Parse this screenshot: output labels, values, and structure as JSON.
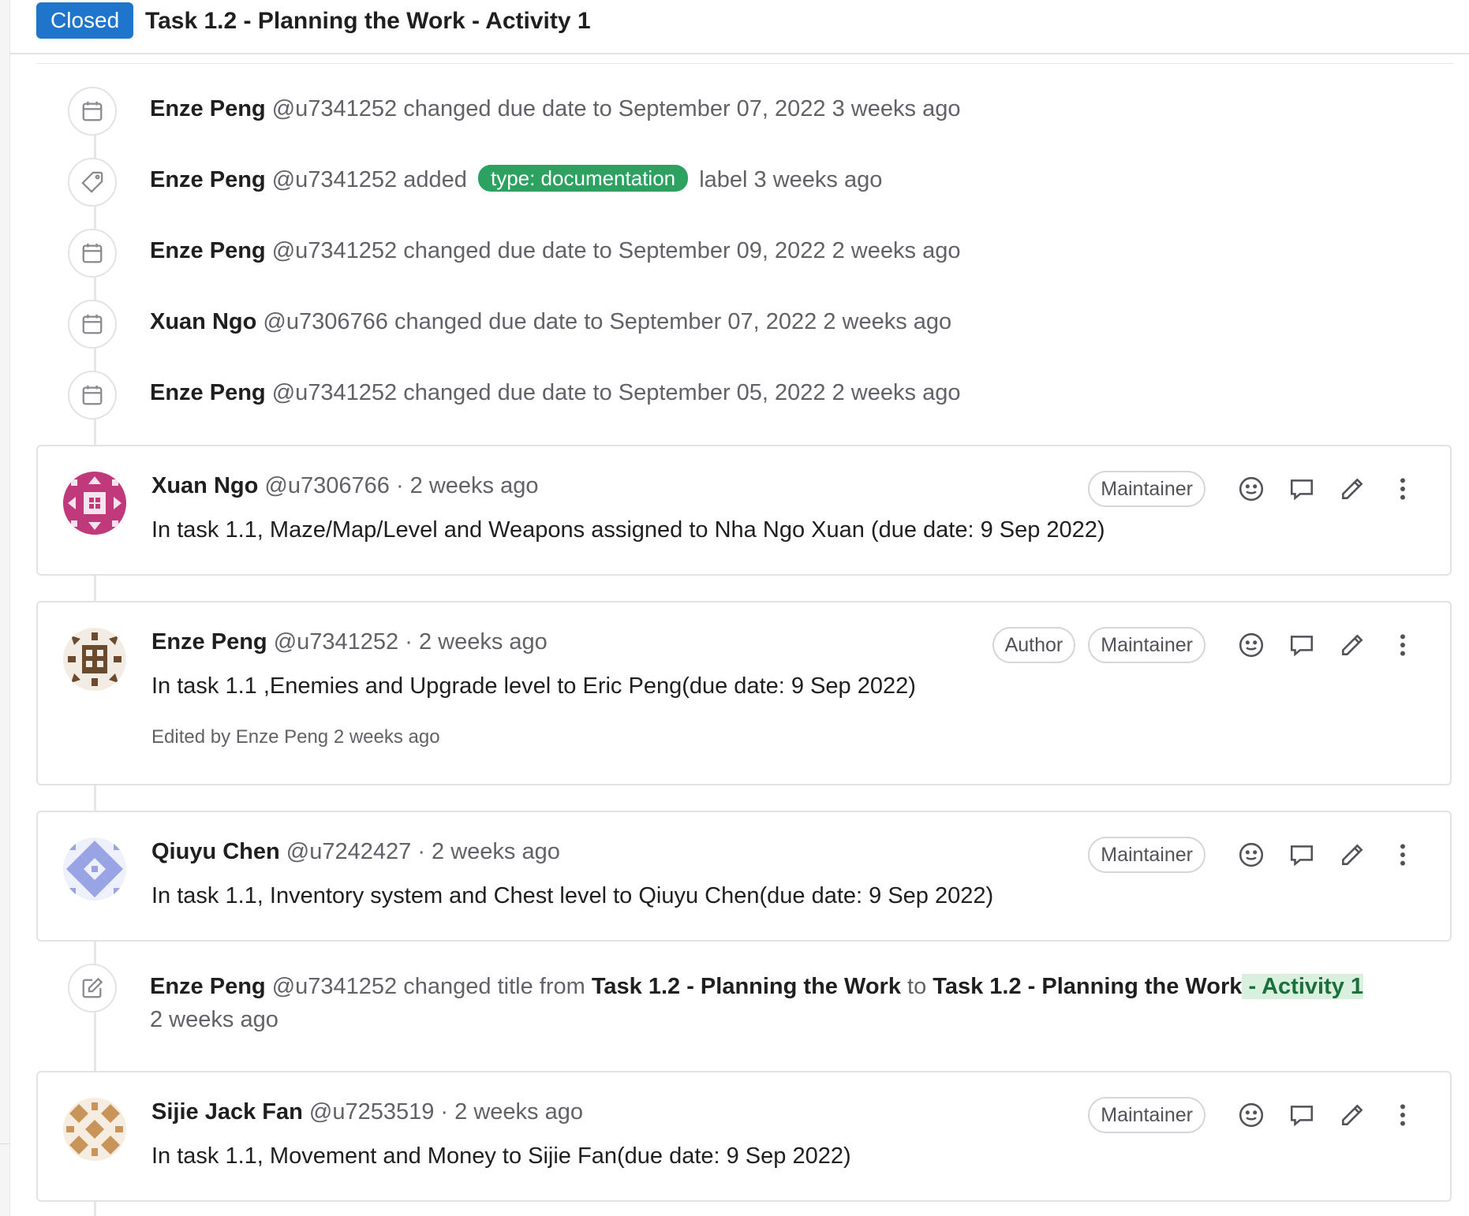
{
  "header": {
    "status": "Closed",
    "title": "Task 1.2 - Planning the Work - Activity 1"
  },
  "events": [
    {
      "icon": "calendar-icon",
      "author": "Enze Peng",
      "username": "@u7341252",
      "action": "changed due date to September 07, 2022",
      "time": "3 weeks ago"
    },
    {
      "icon": "tag-icon",
      "author": "Enze Peng",
      "username": "@u7341252",
      "action": "added",
      "label": "type: documentation",
      "action_suffix": "label",
      "time": "3 weeks ago",
      "label_color": "#2da160"
    },
    {
      "icon": "calendar-icon",
      "author": "Enze Peng",
      "username": "@u7341252",
      "action": "changed due date to September 09, 2022",
      "time": "2 weeks ago"
    },
    {
      "icon": "calendar-icon",
      "author": "Xuan Ngo",
      "username": "@u7306766",
      "action": "changed due date to September 07, 2022",
      "time": "2 weeks ago"
    },
    {
      "icon": "calendar-icon",
      "author": "Enze Peng",
      "username": "@u7341252",
      "action": "changed due date to September 05, 2022",
      "time": "2 weeks ago"
    }
  ],
  "comments": [
    {
      "author": "Xuan Ngo",
      "username": "@u7306766",
      "time": "· 2 weeks ago",
      "badges": [
        "Maintainer"
      ],
      "body": "In task 1.1, Maze/Map/Level and Weapons assigned to Nha Ngo Xuan (due date: 9 Sep 2022)",
      "avatar_color": "#c0397b"
    },
    {
      "author": "Enze Peng",
      "username": "@u7341252",
      "time": "· 2 weeks ago",
      "badges": [
        "Author",
        "Maintainer"
      ],
      "body": "In task 1.1 ,Enemies and Upgrade level to Eric Peng(due date: 9 Sep 2022)",
      "edited": "Edited by Enze Peng 2 weeks ago",
      "avatar_color": "#6b4a2e"
    },
    {
      "author": "Qiuyu Chen",
      "username": "@u7242427",
      "time": "· 2 weeks ago",
      "badges": [
        "Maintainer"
      ],
      "body": "In task 1.1, Inventory system and Chest level to Qiuyu Chen(due date: 9 Sep 2022)",
      "avatar_color": "#98a4e3"
    },
    {
      "author": "Sijie Jack Fan",
      "username": "@u7253519",
      "time": "· 2 weeks ago",
      "badges": [
        "Maintainer"
      ],
      "body": "In task 1.1, Movement and Money to Sijie Fan(due date: 9 Sep 2022)",
      "avatar_color": "#c8945a"
    }
  ],
  "title_change": {
    "icon": "edit-icon",
    "author": "Enze Peng",
    "username": "@u7341252",
    "action": "changed title from",
    "from_title": "Task 1.2 - Planning the Work",
    "to_word": "to",
    "to_title_base": "Task 1.2 - Planning the Work",
    "to_title_added": " - Activity 1",
    "time": "2 weeks ago"
  },
  "colors": {
    "status_closed": "#1f75cb",
    "label_documentation": "#2da160",
    "border": "#e3e3e6",
    "muted_text": "#626168"
  }
}
